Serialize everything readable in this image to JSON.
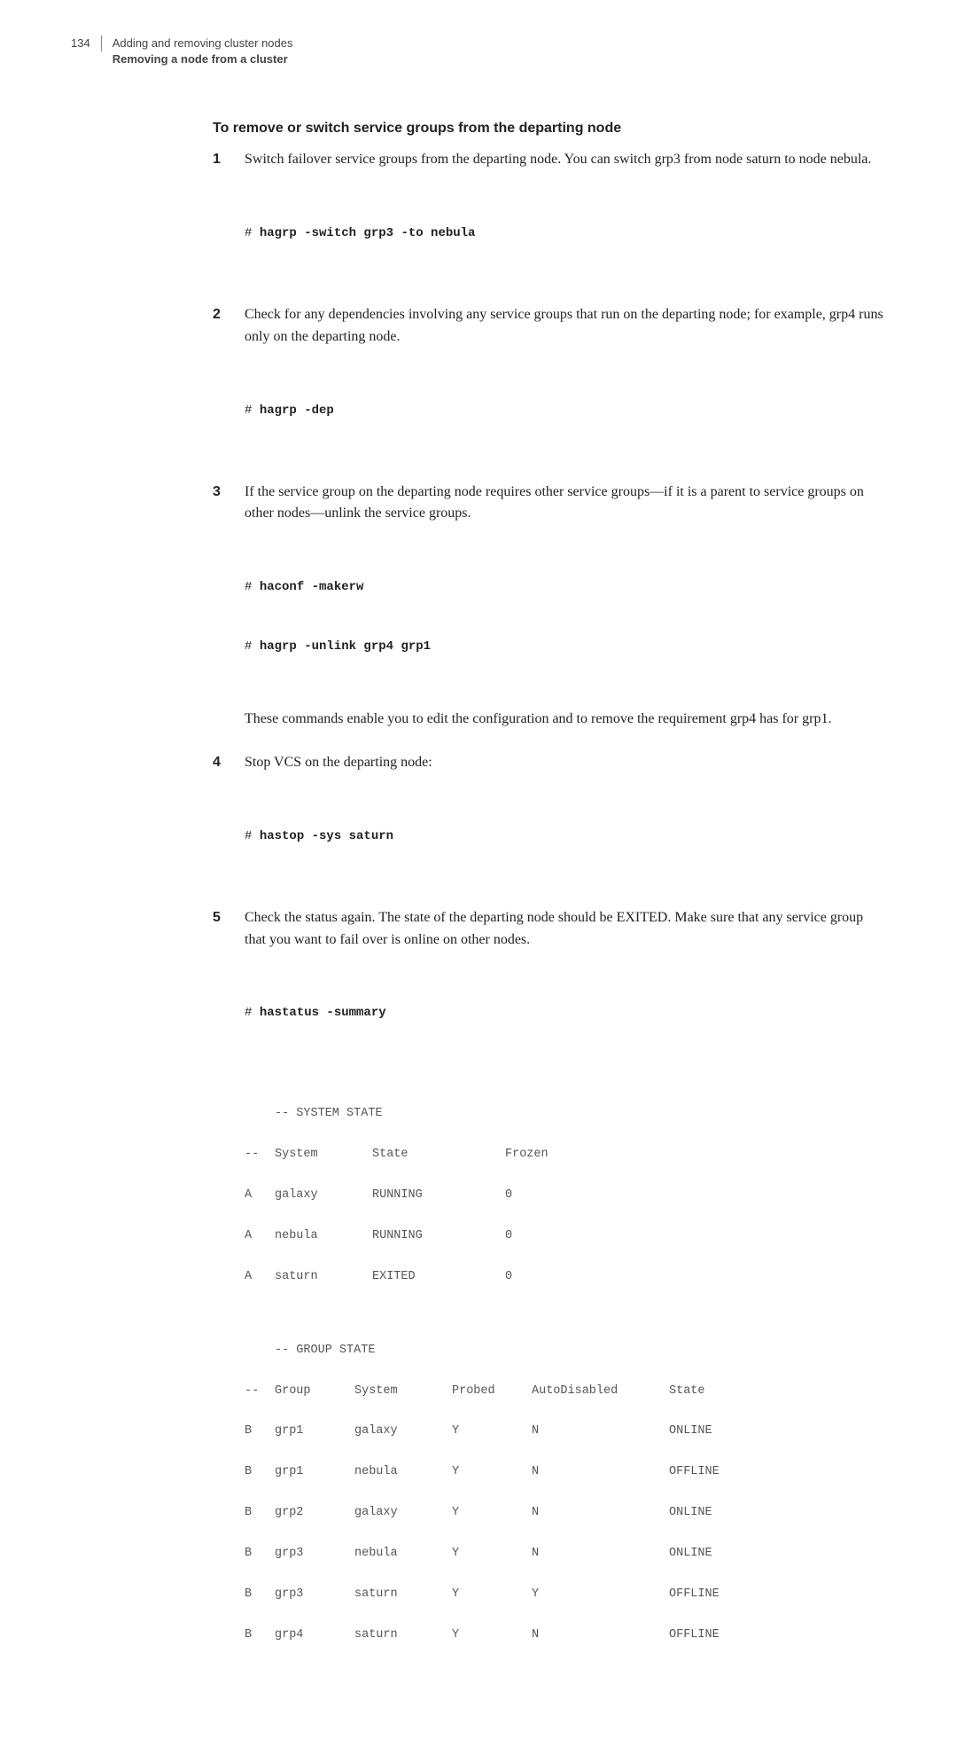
{
  "header": {
    "page_number": "134",
    "chapter": "Adding and removing cluster nodes",
    "section": "Removing a node from a cluster"
  },
  "heading": "To remove or switch service groups from the departing node",
  "steps": [
    {
      "text": "Switch failover service groups from the departing node. You can switch grp3 from node saturn to node nebula.",
      "code": [
        {
          "prompt": "# ",
          "cmd": "hagrp -switch grp3 -to nebula"
        }
      ]
    },
    {
      "text": "Check for any dependencies involving any service groups that run on the departing node; for example, grp4 runs only on the departing node.",
      "code": [
        {
          "prompt": "# ",
          "cmd": "hagrp -dep"
        }
      ]
    },
    {
      "text": "If the service group on the departing node requires other service groups—if it is a parent to service groups on other nodes—unlink the service groups.",
      "code": [
        {
          "prompt": "# ",
          "cmd": "haconf -makerw"
        },
        {
          "prompt": "# ",
          "cmd": "hagrp -unlink grp4 grp1"
        }
      ],
      "after": "These commands enable you to edit the configuration and to remove the requirement grp4 has for grp1."
    },
    {
      "text": "Stop VCS on the departing node:",
      "code": [
        {
          "prompt": "# ",
          "cmd": "hastop -sys saturn"
        }
      ]
    },
    {
      "text": "Check the status again. The state of the departing node should be EXITED. Make sure that any service group that you want to fail over is online on other nodes.",
      "code": [
        {
          "prompt": "# ",
          "cmd": "hastatus -summary"
        }
      ]
    }
  ],
  "output": {
    "system_header": "-- SYSTEM STATE",
    "system_cols": {
      "c0": "--",
      "c1": "System",
      "c2": "State",
      "c3": "Frozen"
    },
    "system_rows": [
      {
        "c0": "A",
        "c1": "galaxy",
        "c2": "RUNNING",
        "c3": "0"
      },
      {
        "c0": "A",
        "c1": "nebula",
        "c2": "RUNNING",
        "c3": "0"
      },
      {
        "c0": "A",
        "c1": "saturn",
        "c2": "EXITED",
        "c3": "0"
      }
    ],
    "group_header": "-- GROUP STATE",
    "group_cols": {
      "c0": "--",
      "c1": "Group",
      "c2": "System",
      "c3": "Probed",
      "c4": "AutoDisabled",
      "c5": "State"
    },
    "group_rows": [
      {
        "c0": "B",
        "c1": "grp1",
        "c2": "galaxy",
        "c3": "Y",
        "c4": "N",
        "c5": "ONLINE"
      },
      {
        "c0": "B",
        "c1": "grp1",
        "c2": "nebula",
        "c3": "Y",
        "c4": "N",
        "c5": "OFFLINE"
      },
      {
        "c0": "B",
        "c1": "grp2",
        "c2": "galaxy",
        "c3": "Y",
        "c4": "N",
        "c5": "ONLINE"
      },
      {
        "c0": "B",
        "c1": "grp3",
        "c2": "nebula",
        "c3": "Y",
        "c4": "N",
        "c5": "ONLINE"
      },
      {
        "c0": "B",
        "c1": "grp3",
        "c2": "saturn",
        "c3": "Y",
        "c4": "Y",
        "c5": "OFFLINE"
      },
      {
        "c0": "B",
        "c1": "grp4",
        "c2": "saturn",
        "c3": "Y",
        "c4": "N",
        "c5": "OFFLINE"
      }
    ]
  }
}
